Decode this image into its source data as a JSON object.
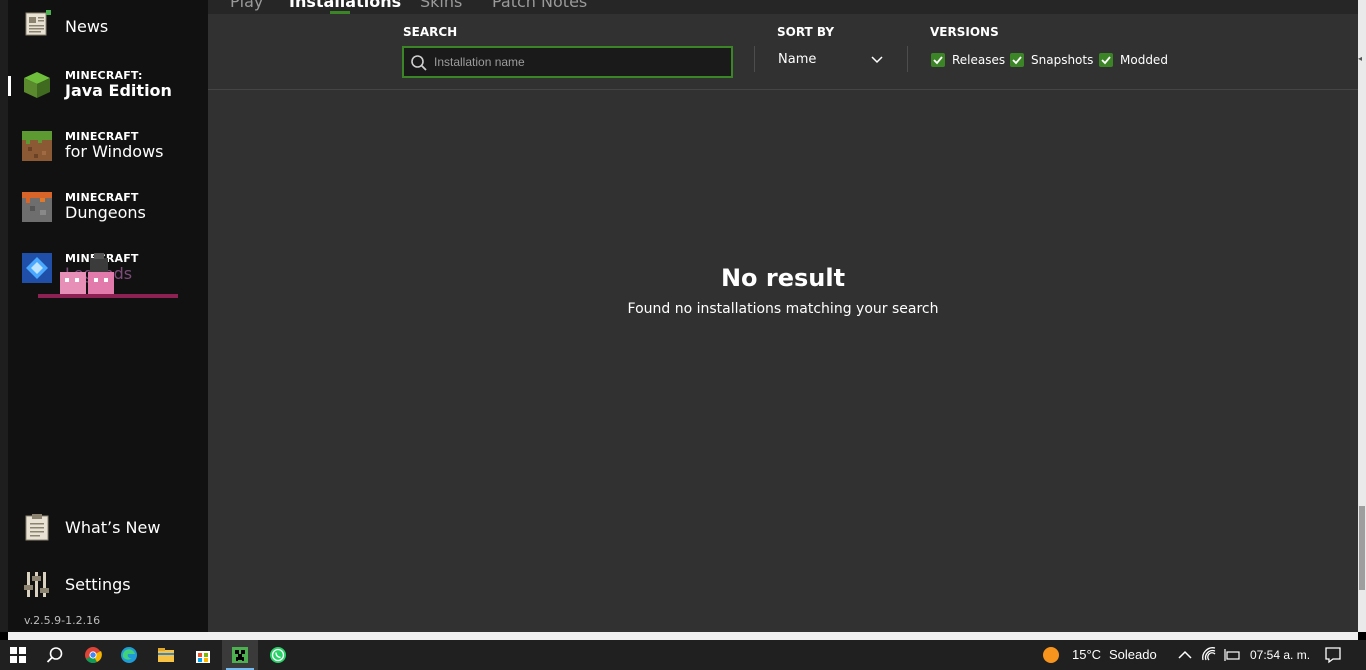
{
  "top_tabs": [
    {
      "label": "Play"
    },
    {
      "label": "Installations"
    },
    {
      "label": "Skins"
    },
    {
      "label": "Patch Notes"
    }
  ],
  "sidebar": {
    "news_label": "News",
    "items": [
      {
        "small": "MINECRAFT:",
        "sub": "Java Edition",
        "active": true
      },
      {
        "small": "MINECRAFT",
        "sub": "for Windows"
      },
      {
        "small": "MINECRAFT",
        "sub": "Dungeons"
      },
      {
        "small": "MINECRAFT",
        "sub": "Legends"
      }
    ],
    "whats_new_label": "What’s New",
    "settings_label": "Settings",
    "version": "v.2.5.9-1.2.16"
  },
  "filters": {
    "search_label": "SEARCH",
    "search_placeholder": "Installation name",
    "search_value": "",
    "sort_label": "SORT BY",
    "sort_value": "Name",
    "versions_label": "VERSIONS",
    "checkboxes": [
      {
        "label": "Releases",
        "checked": true
      },
      {
        "label": "Snapshots",
        "checked": true
      },
      {
        "label": "Modded",
        "checked": true
      }
    ]
  },
  "empty_state": {
    "title": "No result",
    "message": "Found no installations matching your search"
  },
  "colors": {
    "accent_green": "#3c8527",
    "sidebar_bg": "#111111",
    "main_bg": "#313131",
    "taskbar_bg": "#202020"
  },
  "taskbar": {
    "apps": [
      "windows-start",
      "search",
      "chrome",
      "edge",
      "file-explorer",
      "microsoft-store",
      "minecraft-launcher",
      "whatsapp"
    ],
    "active_app": "minecraft-launcher",
    "weather_temp": "15°C",
    "weather_text": "Soleado",
    "clock": "07:54 a. m."
  }
}
